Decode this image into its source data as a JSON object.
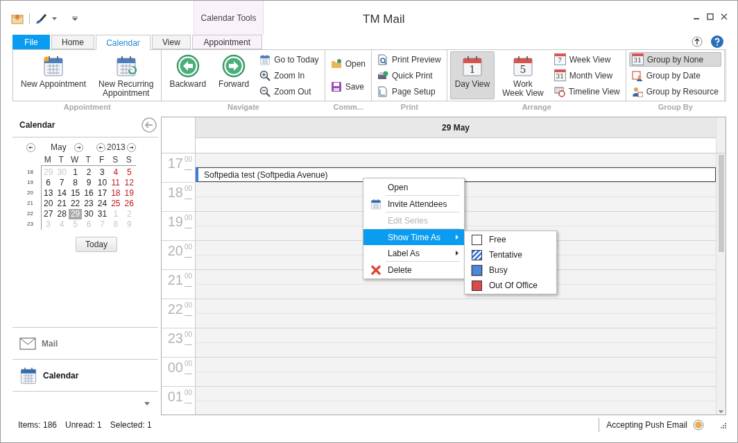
{
  "window": {
    "title": "TM Mail",
    "contextual_group": "Calendar Tools"
  },
  "tabs": [
    {
      "label": "File",
      "kind": "file",
      "selected": false
    },
    {
      "label": "Home",
      "kind": "tab",
      "selected": false
    },
    {
      "label": "Calendar",
      "kind": "tab",
      "selected": true
    },
    {
      "label": "View",
      "kind": "tab",
      "selected": false
    },
    {
      "label": "Appointment",
      "kind": "contextual",
      "selected": false
    }
  ],
  "ribbon_groups": [
    {
      "label": "Appointment",
      "items": [
        {
          "label": "New Appointment",
          "kind": "large",
          "selected": false
        },
        {
          "label": "New Recurring\nAppointment",
          "kind": "large",
          "selected": false
        }
      ]
    },
    {
      "label": "Navigate",
      "items": [
        {
          "label": "Backward",
          "kind": "large",
          "selected": false
        },
        {
          "label": "Forward",
          "kind": "large",
          "selected": false
        },
        {
          "label": "Go to Today",
          "kind": "small",
          "selected": false
        },
        {
          "label": "Zoom In",
          "kind": "small",
          "selected": false
        },
        {
          "label": "Zoom Out",
          "kind": "small",
          "selected": false
        }
      ]
    },
    {
      "label": "Comm...",
      "items": [
        {
          "label": "Open",
          "kind": "small",
          "selected": false
        },
        {
          "label": "Save",
          "kind": "small",
          "selected": false
        }
      ]
    },
    {
      "label": "Print",
      "items": [
        {
          "label": "Print Preview",
          "kind": "small",
          "selected": false
        },
        {
          "label": "Quick Print",
          "kind": "small",
          "selected": false
        },
        {
          "label": "Page Setup",
          "kind": "small",
          "selected": false
        }
      ]
    },
    {
      "label": "Arrange",
      "items": [
        {
          "label": "Day View",
          "kind": "large",
          "selected": true,
          "icon_text": "1"
        },
        {
          "label": "Work\nWeek View",
          "kind": "large",
          "selected": false,
          "icon_text": "5"
        },
        {
          "label": "Week View",
          "kind": "small",
          "selected": false,
          "icon_text": "7"
        },
        {
          "label": "Month View",
          "kind": "small",
          "selected": false,
          "icon_text": "31"
        },
        {
          "label": "Timeline View",
          "kind": "small",
          "selected": false
        }
      ]
    },
    {
      "label": "Group By",
      "items": [
        {
          "label": "Group by None",
          "kind": "small",
          "selected": true,
          "icon_text": "31"
        },
        {
          "label": "Group by Date",
          "kind": "small",
          "selected": false
        },
        {
          "label": "Group by Resource",
          "kind": "small",
          "selected": false
        }
      ]
    }
  ],
  "sidebar": {
    "title": "Calendar",
    "mini_calendar": {
      "month": "May",
      "year": "2013",
      "weekdays": [
        "M",
        "T",
        "W",
        "T",
        "F",
        "S",
        "S"
      ],
      "weeks": [
        {
          "number": "18",
          "days": [
            {
              "label": "29",
              "kind": "other",
              "selected": false
            },
            {
              "label": "30",
              "kind": "other",
              "selected": false
            },
            {
              "label": "1",
              "kind": "day",
              "selected": false
            },
            {
              "label": "2",
              "kind": "day",
              "selected": false
            },
            {
              "label": "3",
              "kind": "day",
              "selected": false
            },
            {
              "label": "4",
              "kind": "weekend",
              "selected": false
            },
            {
              "label": "5",
              "kind": "weekend",
              "selected": false
            }
          ]
        },
        {
          "number": "19",
          "days": [
            {
              "label": "6",
              "kind": "day",
              "selected": false
            },
            {
              "label": "7",
              "kind": "day",
              "selected": false
            },
            {
              "label": "8",
              "kind": "day",
              "selected": false
            },
            {
              "label": "9",
              "kind": "day",
              "selected": false
            },
            {
              "label": "10",
              "kind": "day",
              "selected": false
            },
            {
              "label": "11",
              "kind": "weekend",
              "selected": false
            },
            {
              "label": "12",
              "kind": "weekend",
              "selected": false
            }
          ]
        },
        {
          "number": "20",
          "days": [
            {
              "label": "13",
              "kind": "day",
              "selected": false
            },
            {
              "label": "14",
              "kind": "day",
              "selected": false
            },
            {
              "label": "15",
              "kind": "day",
              "selected": false
            },
            {
              "label": "16",
              "kind": "day",
              "selected": false
            },
            {
              "label": "17",
              "kind": "day",
              "selected": false
            },
            {
              "label": "18",
              "kind": "weekend",
              "selected": false
            },
            {
              "label": "19",
              "kind": "weekend",
              "selected": false
            }
          ]
        },
        {
          "number": "21",
          "days": [
            {
              "label": "20",
              "kind": "day",
              "selected": false
            },
            {
              "label": "21",
              "kind": "day",
              "selected": false
            },
            {
              "label": "22",
              "kind": "day",
              "selected": false
            },
            {
              "label": "23",
              "kind": "day",
              "selected": false
            },
            {
              "label": "24",
              "kind": "day",
              "selected": false
            },
            {
              "label": "25",
              "kind": "weekend",
              "selected": false
            },
            {
              "label": "26",
              "kind": "weekend",
              "selected": false
            }
          ]
        },
        {
          "number": "22",
          "days": [
            {
              "label": "27",
              "kind": "day",
              "selected": false
            },
            {
              "label": "28",
              "kind": "day",
              "selected": false
            },
            {
              "label": "29",
              "kind": "day",
              "selected": true
            },
            {
              "label": "30",
              "kind": "day",
              "selected": false
            },
            {
              "label": "31",
              "kind": "day",
              "selected": false
            },
            {
              "label": "1",
              "kind": "other",
              "selected": false
            },
            {
              "label": "2",
              "kind": "other",
              "selected": false
            }
          ]
        },
        {
          "number": "23",
          "days": [
            {
              "label": "3",
              "kind": "other",
              "selected": false
            },
            {
              "label": "4",
              "kind": "other",
              "selected": false
            },
            {
              "label": "5",
              "kind": "other",
              "selected": false
            },
            {
              "label": "6",
              "kind": "other",
              "selected": false
            },
            {
              "label": "7",
              "kind": "other",
              "selected": false
            },
            {
              "label": "8",
              "kind": "other",
              "selected": false
            },
            {
              "label": "9",
              "kind": "other",
              "selected": false
            }
          ]
        }
      ],
      "today_button": "Today"
    },
    "nav_items": [
      {
        "label": "Mail",
        "selected": false
      },
      {
        "label": "Calendar",
        "selected": true
      }
    ]
  },
  "day_view": {
    "date_header": "29 May",
    "hours": [
      {
        "hour": "17",
        "minutes": "00"
      },
      {
        "hour": "18",
        "minutes": "00"
      },
      {
        "hour": "19",
        "minutes": "00"
      },
      {
        "hour": "20",
        "minutes": "00"
      },
      {
        "hour": "21",
        "minutes": "00"
      },
      {
        "hour": "22",
        "minutes": "00"
      },
      {
        "hour": "23",
        "minutes": "00"
      },
      {
        "hour": "00",
        "minutes": "00"
      },
      {
        "hour": "01",
        "minutes": "00"
      }
    ],
    "event": {
      "title": "Softpedia test (Softpedia Avenue)"
    }
  },
  "context_menu": {
    "items": [
      {
        "label": "Open",
        "disabled": false,
        "selected": false,
        "submenu": false,
        "divider_below": true
      },
      {
        "label": "Invite Attendees",
        "disabled": false,
        "selected": false,
        "submenu": false,
        "divider_below": true
      },
      {
        "label": "Edit Series",
        "disabled": true,
        "selected": false,
        "submenu": false,
        "divider_below": true
      },
      {
        "label": "Show Time As",
        "disabled": false,
        "selected": true,
        "submenu": true,
        "divider_below": false
      },
      {
        "label": "Label As",
        "disabled": false,
        "selected": false,
        "submenu": true,
        "divider_below": true
      },
      {
        "label": "Delete",
        "disabled": false,
        "selected": false,
        "submenu": false,
        "divider_below": false
      }
    ],
    "submenu": [
      {
        "label": "Free",
        "kind": "empty",
        "color": "#ffffff",
        "selected": false
      },
      {
        "label": "Tentative",
        "kind": "striped",
        "color": "#3f7de0",
        "selected": false
      },
      {
        "label": "Busy",
        "kind": "solid",
        "color": "#4a88e0",
        "selected": true
      },
      {
        "label": "Out Of Office",
        "kind": "solid",
        "color": "#dd4a4a",
        "selected": false
      }
    ]
  },
  "status_bar": {
    "items": [
      "Items: 186",
      "Unread: 1",
      "Selected: 1"
    ],
    "connection": "Accepting Push Email"
  }
}
